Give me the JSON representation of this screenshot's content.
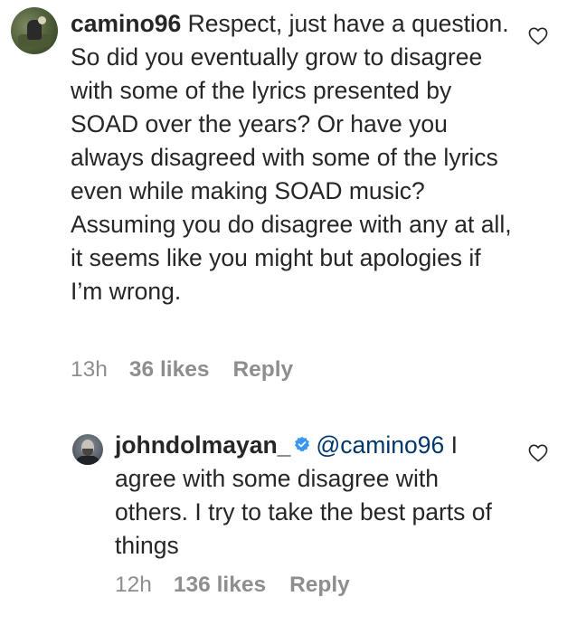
{
  "comments": [
    {
      "username": "camino96",
      "text": "Respect, just have a question. So did you eventually grow to disagree with some of the lyrics presented by SOAD over the years? Or have you always disagreed with some of the lyrics even while making SOAD music? Assuming you do disagree with any at all, it seems like you might but apologies if I’m wrong.",
      "time": "13h",
      "likes": "36 likes",
      "reply_label": "Reply",
      "avatar_icon": "user-avatar-photo",
      "like_icon": "heart-outline-icon"
    },
    {
      "username": "johndolmayan_",
      "verified_icon": "verified-badge-icon",
      "mention": "@camino96",
      "text": "I agree with some disagree with others. I try to take the best parts of things",
      "time": "12h",
      "likes": "136 likes",
      "reply_label": "Reply",
      "avatar_icon": "user-avatar-photo",
      "like_icon": "heart-outline-icon"
    }
  ],
  "colors": {
    "text": "#262626",
    "meta": "#8e8e8e",
    "mention": "#00376b",
    "verified": "#3897f0"
  }
}
